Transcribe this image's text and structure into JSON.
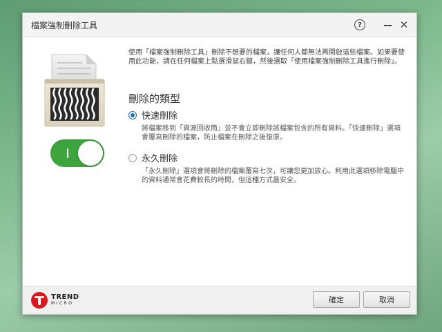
{
  "window": {
    "title": "檔案強制刪除工具",
    "help_glyph": "?",
    "close_glyph": "✕"
  },
  "description": "使用「檔案強制刪除工具」刪除不想要的檔案，讓任何人都無法再開啟這些檔案。如果要使用此功能，請在任何檔案上點選滑鼠右鍵，然後選取「使用檔案強制刪除工具進行刪除」。",
  "toggle": {
    "state": "on",
    "on_symbol": "I"
  },
  "delete_type": {
    "heading": "刪除的類型",
    "options": [
      {
        "label": "快速刪除",
        "selected": true,
        "desc": "將檔案移到「資源回收筒」並不會立即刪除該檔案包含的所有資料。「快速刪除」選項會覆寫刪除的檔案，防止檔案在刪除之後復原。"
      },
      {
        "label": "永久刪除",
        "selected": false,
        "desc": "「永久刪除」選項會將刪除的檔案覆寫七次，可讓您更加放心。利用此選項移除電腦中的資料通常會花費較長的時間，但這種方式最安全。"
      }
    ]
  },
  "footer": {
    "logo_line1": "TREND",
    "logo_line2": "MICRO",
    "ok_label": "確定",
    "cancel_label": "取消"
  },
  "colors": {
    "toggle_on": "#3ea43d",
    "radio_selected": "#1e6fc6",
    "brand_red": "#d71920"
  }
}
